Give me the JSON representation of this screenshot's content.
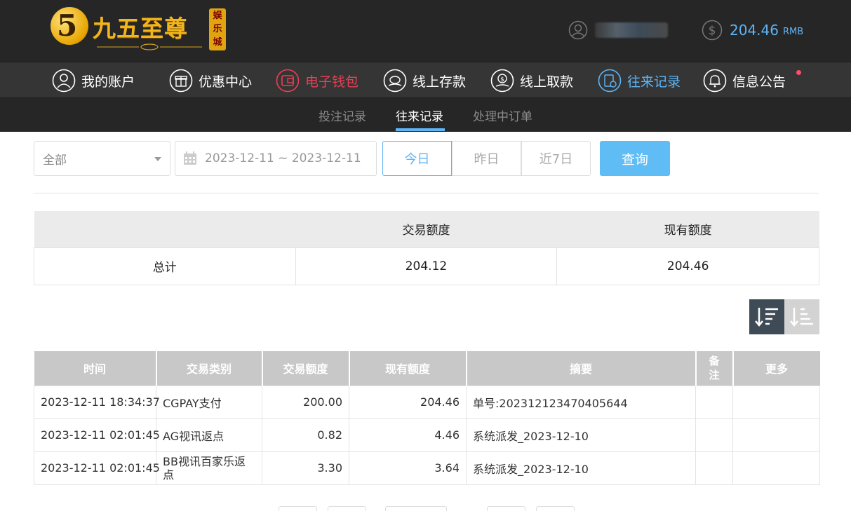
{
  "header": {
    "logo_text": "九五至尊",
    "logo_tag": "娱乐城",
    "balance": "204.46",
    "currency": "RMB",
    "accent_color": "#5fb4f5"
  },
  "mainnav": {
    "items": [
      {
        "label": "我的账户",
        "icon": "user-circle-icon"
      },
      {
        "label": "优惠中心",
        "icon": "gift-icon"
      },
      {
        "label": "电子钱包",
        "icon": "wallet-icon"
      },
      {
        "label": "线上存款",
        "icon": "deposit-icon"
      },
      {
        "label": "线上取款",
        "icon": "withdraw-icon"
      },
      {
        "label": "往来记录",
        "icon": "records-icon"
      },
      {
        "label": "信息公告",
        "icon": "bell-icon"
      }
    ],
    "active_color": "#5fb4f5",
    "highlight_color": "#ea4055"
  },
  "subnav": {
    "tabs": [
      "投注记录",
      "往来记录",
      "处理中订单"
    ],
    "active": "往来记录"
  },
  "filters": {
    "type_value": "全部",
    "date_range": "2023-12-11 ~ 2023-12-11",
    "quick": [
      "今日",
      "昨日",
      "近7日"
    ],
    "query_label": "查询"
  },
  "summary": {
    "headers": [
      "",
      "交易额度",
      "现有额度"
    ],
    "row": {
      "label": "总计",
      "amount": "204.12",
      "current": "204.46"
    }
  },
  "records": {
    "headers": [
      "时间",
      "交易类别",
      "交易额度",
      "现有额度",
      "摘要",
      "备注",
      "更多"
    ],
    "rows": [
      {
        "time": "2023-12-11 18:34:37",
        "type": "CGPAY支付",
        "amount": "200.00",
        "balance": "204.46",
        "summary": "单号:202312123470405644",
        "note": "",
        "more": ""
      },
      {
        "time": "2023-12-11 02:01:45",
        "type": "AG视讯返点",
        "amount": "0.82",
        "balance": "4.46",
        "summary": "系统派发_2023-12-10",
        "note": "",
        "more": ""
      },
      {
        "time": "2023-12-11 02:01:45",
        "type": "BB视讯百家乐返点",
        "amount": "3.30",
        "balance": "3.64",
        "summary": "系统派发_2023-12-10",
        "note": "",
        "more": ""
      }
    ]
  }
}
